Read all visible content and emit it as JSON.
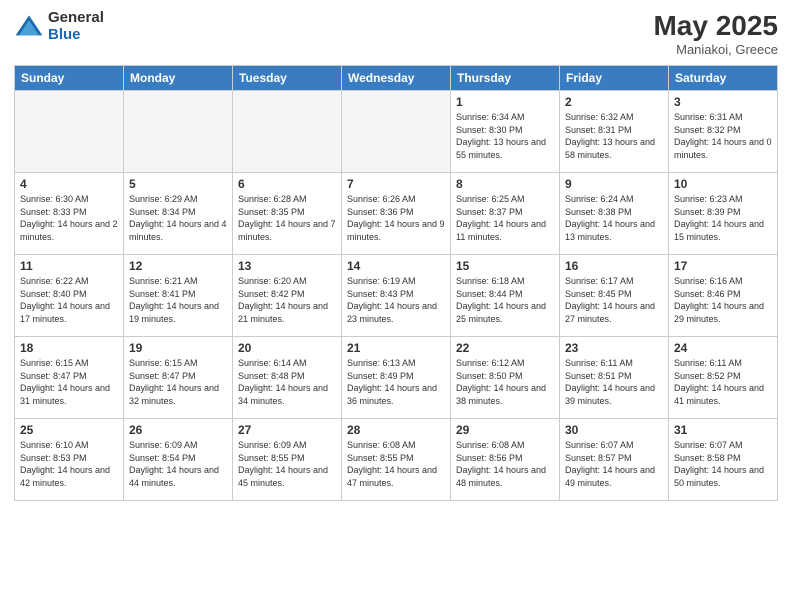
{
  "logo": {
    "general": "General",
    "blue": "Blue"
  },
  "header": {
    "month": "May 2025",
    "location": "Maniakoi, Greece"
  },
  "days_of_week": [
    "Sunday",
    "Monday",
    "Tuesday",
    "Wednesday",
    "Thursday",
    "Friday",
    "Saturday"
  ],
  "weeks": [
    [
      {
        "day": "",
        "empty": true
      },
      {
        "day": "",
        "empty": true
      },
      {
        "day": "",
        "empty": true
      },
      {
        "day": "",
        "empty": true
      },
      {
        "day": "1",
        "sunrise": "6:34 AM",
        "sunset": "8:30 PM",
        "daylight": "13 hours and 55 minutes."
      },
      {
        "day": "2",
        "sunrise": "6:32 AM",
        "sunset": "8:31 PM",
        "daylight": "13 hours and 58 minutes."
      },
      {
        "day": "3",
        "sunrise": "6:31 AM",
        "sunset": "8:32 PM",
        "daylight": "14 hours and 0 minutes."
      }
    ],
    [
      {
        "day": "4",
        "sunrise": "6:30 AM",
        "sunset": "8:33 PM",
        "daylight": "14 hours and 2 minutes."
      },
      {
        "day": "5",
        "sunrise": "6:29 AM",
        "sunset": "8:34 PM",
        "daylight": "14 hours and 4 minutes."
      },
      {
        "day": "6",
        "sunrise": "6:28 AM",
        "sunset": "8:35 PM",
        "daylight": "14 hours and 7 minutes."
      },
      {
        "day": "7",
        "sunrise": "6:26 AM",
        "sunset": "8:36 PM",
        "daylight": "14 hours and 9 minutes."
      },
      {
        "day": "8",
        "sunrise": "6:25 AM",
        "sunset": "8:37 PM",
        "daylight": "14 hours and 11 minutes."
      },
      {
        "day": "9",
        "sunrise": "6:24 AM",
        "sunset": "8:38 PM",
        "daylight": "14 hours and 13 minutes."
      },
      {
        "day": "10",
        "sunrise": "6:23 AM",
        "sunset": "8:39 PM",
        "daylight": "14 hours and 15 minutes."
      }
    ],
    [
      {
        "day": "11",
        "sunrise": "6:22 AM",
        "sunset": "8:40 PM",
        "daylight": "14 hours and 17 minutes."
      },
      {
        "day": "12",
        "sunrise": "6:21 AM",
        "sunset": "8:41 PM",
        "daylight": "14 hours and 19 minutes."
      },
      {
        "day": "13",
        "sunrise": "6:20 AM",
        "sunset": "8:42 PM",
        "daylight": "14 hours and 21 minutes."
      },
      {
        "day": "14",
        "sunrise": "6:19 AM",
        "sunset": "8:43 PM",
        "daylight": "14 hours and 23 minutes."
      },
      {
        "day": "15",
        "sunrise": "6:18 AM",
        "sunset": "8:44 PM",
        "daylight": "14 hours and 25 minutes."
      },
      {
        "day": "16",
        "sunrise": "6:17 AM",
        "sunset": "8:45 PM",
        "daylight": "14 hours and 27 minutes."
      },
      {
        "day": "17",
        "sunrise": "6:16 AM",
        "sunset": "8:46 PM",
        "daylight": "14 hours and 29 minutes."
      }
    ],
    [
      {
        "day": "18",
        "sunrise": "6:15 AM",
        "sunset": "8:47 PM",
        "daylight": "14 hours and 31 minutes."
      },
      {
        "day": "19",
        "sunrise": "6:15 AM",
        "sunset": "8:47 PM",
        "daylight": "14 hours and 32 minutes."
      },
      {
        "day": "20",
        "sunrise": "6:14 AM",
        "sunset": "8:48 PM",
        "daylight": "14 hours and 34 minutes."
      },
      {
        "day": "21",
        "sunrise": "6:13 AM",
        "sunset": "8:49 PM",
        "daylight": "14 hours and 36 minutes."
      },
      {
        "day": "22",
        "sunrise": "6:12 AM",
        "sunset": "8:50 PM",
        "daylight": "14 hours and 38 minutes."
      },
      {
        "day": "23",
        "sunrise": "6:11 AM",
        "sunset": "8:51 PM",
        "daylight": "14 hours and 39 minutes."
      },
      {
        "day": "24",
        "sunrise": "6:11 AM",
        "sunset": "8:52 PM",
        "daylight": "14 hours and 41 minutes."
      }
    ],
    [
      {
        "day": "25",
        "sunrise": "6:10 AM",
        "sunset": "8:53 PM",
        "daylight": "14 hours and 42 minutes."
      },
      {
        "day": "26",
        "sunrise": "6:09 AM",
        "sunset": "8:54 PM",
        "daylight": "14 hours and 44 minutes."
      },
      {
        "day": "27",
        "sunrise": "6:09 AM",
        "sunset": "8:55 PM",
        "daylight": "14 hours and 45 minutes."
      },
      {
        "day": "28",
        "sunrise": "6:08 AM",
        "sunset": "8:55 PM",
        "daylight": "14 hours and 47 minutes."
      },
      {
        "day": "29",
        "sunrise": "6:08 AM",
        "sunset": "8:56 PM",
        "daylight": "14 hours and 48 minutes."
      },
      {
        "day": "30",
        "sunrise": "6:07 AM",
        "sunset": "8:57 PM",
        "daylight": "14 hours and 49 minutes."
      },
      {
        "day": "31",
        "sunrise": "6:07 AM",
        "sunset": "8:58 PM",
        "daylight": "14 hours and 50 minutes."
      }
    ]
  ]
}
